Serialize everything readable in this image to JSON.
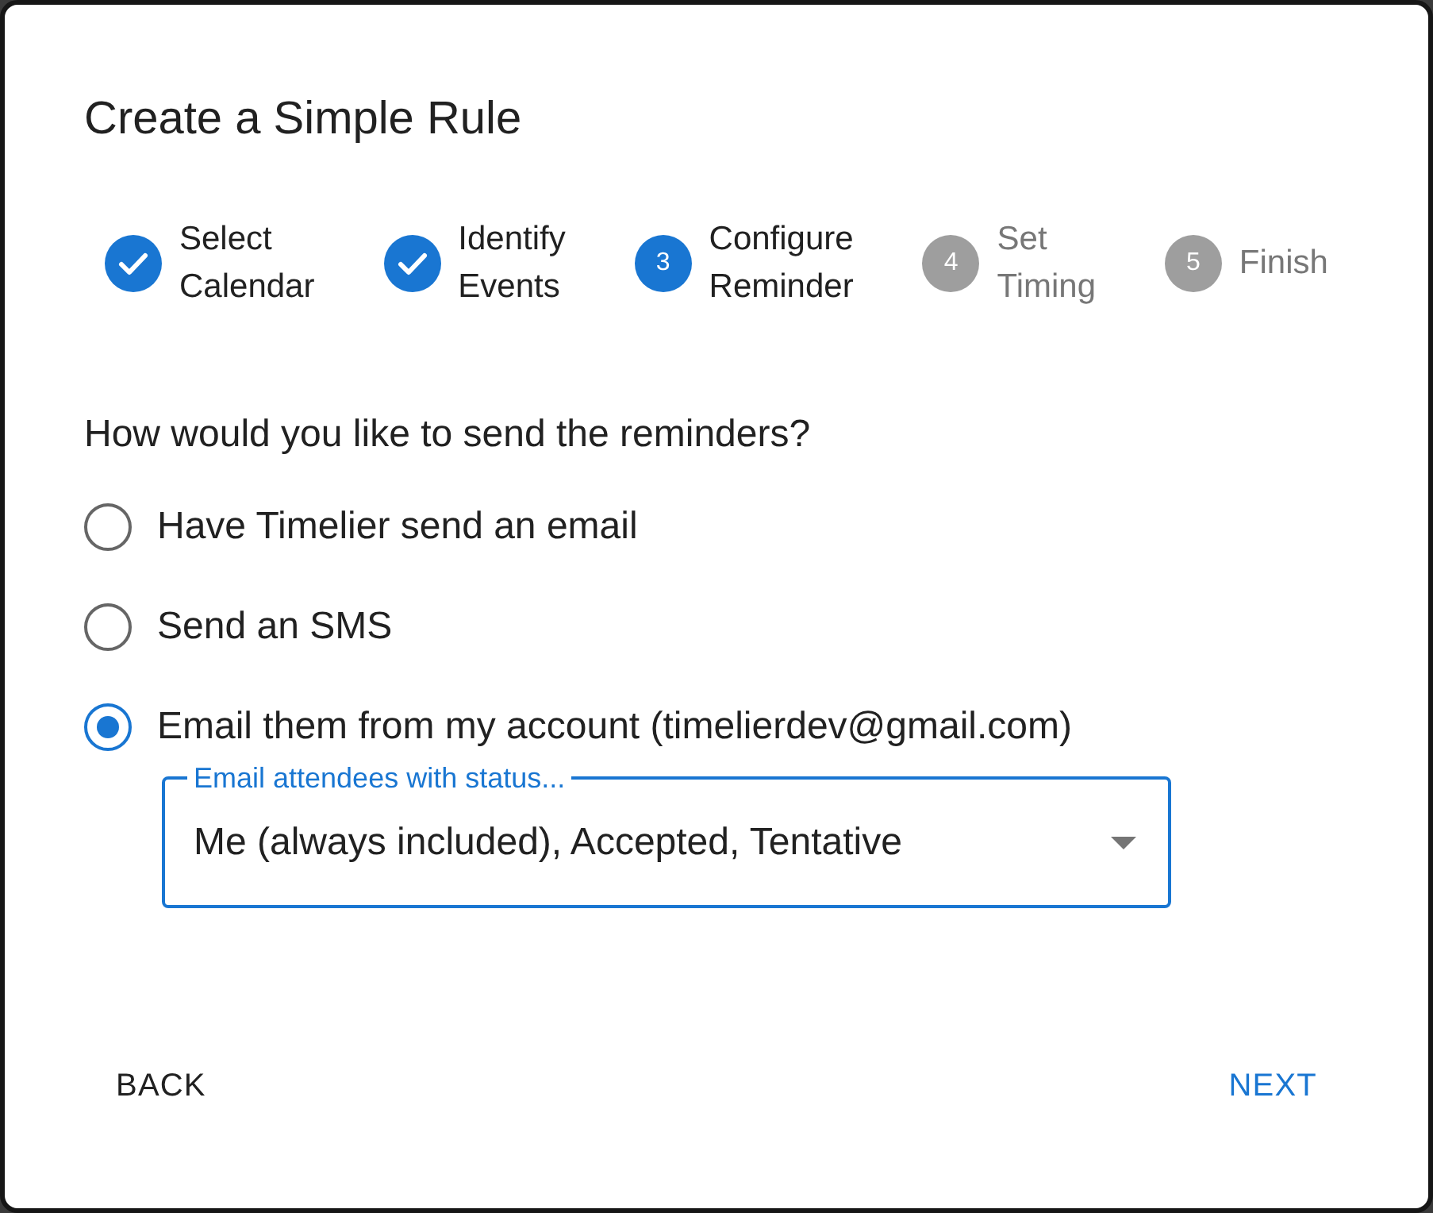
{
  "dialog": {
    "title": "Create a Simple Rule"
  },
  "steps": [
    {
      "label": "Select Calendar",
      "kind": "completed"
    },
    {
      "label": "Identify Events",
      "kind": "completed"
    },
    {
      "number": "3",
      "label": "Configure Reminder",
      "kind": "active"
    },
    {
      "number": "4",
      "label": "Set Timing",
      "kind": "pending"
    },
    {
      "number": "5",
      "label": "Finish",
      "kind": "pending"
    }
  ],
  "question": "How would you like to send the reminders?",
  "options": [
    {
      "label": "Have Timelier send an email",
      "selected": false
    },
    {
      "label": "Send an SMS",
      "selected": false
    },
    {
      "label": "Email them from my account (timelierdev@gmail.com)",
      "selected": true
    }
  ],
  "attendee_status_select": {
    "label": "Email attendees with status...",
    "value": "Me (always included), Accepted, Tentative"
  },
  "buttons": [
    {
      "label": "BACK",
      "kind": "secondary"
    },
    {
      "label": "NEXT",
      "kind": "primary"
    }
  ]
}
